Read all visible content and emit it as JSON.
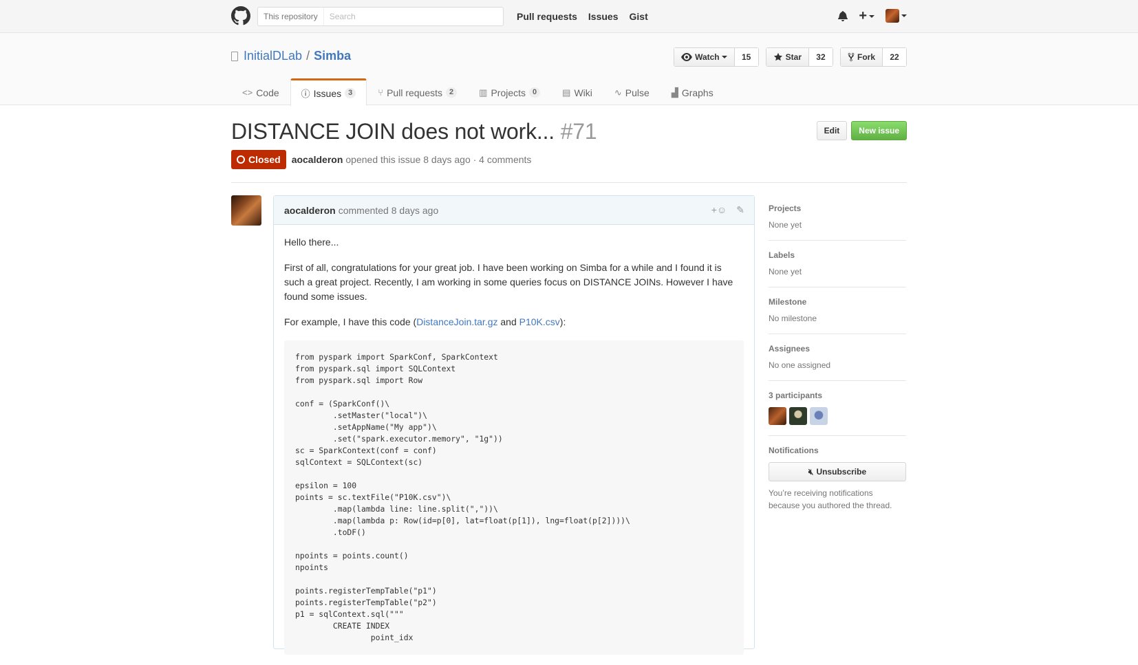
{
  "header": {
    "scope_label": "This repository",
    "search_placeholder": "Search",
    "nav": [
      "Pull requests",
      "Issues",
      "Gist"
    ]
  },
  "repo": {
    "owner": "InitialDLab",
    "name": "Simba",
    "watch_label": "Watch",
    "watch_count": "15",
    "star_label": "Star",
    "star_count": "32",
    "fork_label": "Fork",
    "fork_count": "22"
  },
  "reponav": {
    "code": "Code",
    "issues": "Issues",
    "issues_count": "3",
    "pulls": "Pull requests",
    "pulls_count": "2",
    "projects": "Projects",
    "projects_count": "0",
    "wiki": "Wiki",
    "pulse": "Pulse",
    "graphs": "Graphs"
  },
  "issue": {
    "title": "DISTANCE JOIN does not work...",
    "number": "#71",
    "edit_label": "Edit",
    "new_issue_label": "New issue",
    "state": "Closed",
    "author": "aocalderon",
    "meta": "opened this issue 8 days ago · 4 comments",
    "accent_closed": "#bd2c00"
  },
  "comment": {
    "author": "aocalderon",
    "meta": "commented 8 days ago",
    "greeting": "Hello there...",
    "paragraph": "First of all, congratulations for your great job. I have been working on Simba for a while and I found it is such a great project. Recently, I am working in some queries focus on DISTANCE JOINs. However I have found some issues.",
    "example_prefix": "For example, I have this code (",
    "link1": "DistanceJoin.tar.gz",
    "example_and": " and ",
    "link2": "P10K.csv",
    "example_suffix": "):",
    "code": "from pyspark import SparkConf, SparkContext\nfrom pyspark.sql import SQLContext\nfrom pyspark.sql import Row\n\nconf = (SparkConf()\\\n        .setMaster(\"local\")\\\n        .setAppName(\"My app\")\\\n        .set(\"spark.executor.memory\", \"1g\"))\nsc = SparkContext(conf = conf)\nsqlContext = SQLContext(sc)\n\nepsilon = 100\npoints = sc.textFile(\"P10K.csv\")\\\n        .map(lambda line: line.split(\",\"))\\\n        .map(lambda p: Row(id=p[0], lat=float(p[1]), lng=float(p[2])))\\\n        .toDF()\n\nnpoints = points.count()\nnpoints\n\npoints.registerTempTable(\"p1\")\npoints.registerTempTable(\"p2\")\np1 = sqlContext.sql(\"\"\"\n        CREATE INDEX\n                point_idx"
  },
  "sidebar": {
    "projects_heading": "Projects",
    "projects_value": "None yet",
    "labels_heading": "Labels",
    "labels_value": "None yet",
    "milestone_heading": "Milestone",
    "milestone_value": "No milestone",
    "assignees_heading": "Assignees",
    "assignees_value": "No one assigned",
    "participants_heading": "3 participants",
    "notifications_heading": "Notifications",
    "unsubscribe_label": "Unsubscribe",
    "notif_reason": "You’re receiving notifications because you authored the thread."
  }
}
